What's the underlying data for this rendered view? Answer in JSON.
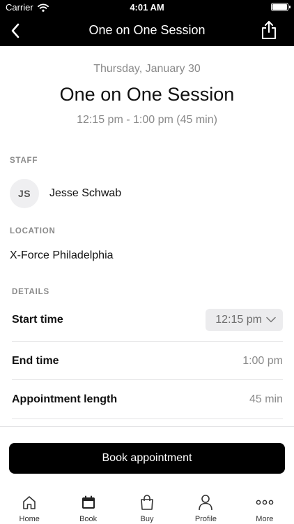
{
  "status_bar": {
    "carrier": "Carrier",
    "time": "4:01 AM"
  },
  "header": {
    "title": "One on One Session"
  },
  "session": {
    "date": "Thursday, January 30",
    "title": "One on One Session",
    "range": "12:15 pm - 1:00 pm (45 min)"
  },
  "staff": {
    "label": "STAFF",
    "initials": "JS",
    "name": "Jesse Schwab"
  },
  "location": {
    "label": "LOCATION",
    "value": "X-Force Philadelphia"
  },
  "details": {
    "label": "DETAILS",
    "start_label": "Start time",
    "start_value": "12:15 pm",
    "end_label": "End time",
    "end_value": "1:00 pm",
    "length_label": "Appointment length",
    "length_value": "45 min"
  },
  "book_button": {
    "label": "Book appointment"
  },
  "tabs": [
    {
      "label": "Home",
      "icon": "home-icon"
    },
    {
      "label": "Book",
      "icon": "calendar-icon",
      "active": true
    },
    {
      "label": "Buy",
      "icon": "shopping-bag-icon"
    },
    {
      "label": "Profile",
      "icon": "person-icon"
    },
    {
      "label": "More",
      "icon": "more-dots-icon"
    }
  ],
  "colors": {
    "header_bg": "#000000",
    "primary_button": "#000000",
    "secondary_text": "#8a8a8a",
    "picker_bg": "#ececee"
  }
}
